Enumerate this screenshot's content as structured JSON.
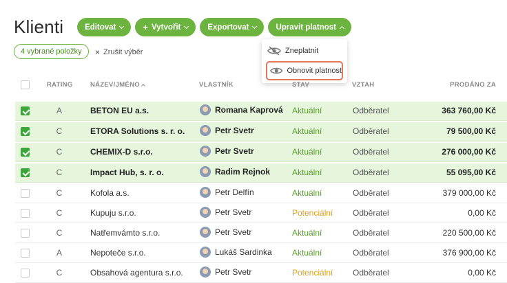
{
  "page": {
    "title": "Klienti"
  },
  "toolbar": {
    "edit_label": "Editovat",
    "create_label": "Vytvořit",
    "export_label": "Exportovat",
    "validity_label": "Upravit platnost"
  },
  "selection": {
    "chip_label": "4 vybrané položky",
    "clear_label": "Zrušit výběr"
  },
  "dropdown": {
    "items": [
      {
        "label": "Zneplatnit",
        "icon": "eye-off-icon"
      },
      {
        "label": "Obnovit platnost",
        "icon": "eye-icon"
      }
    ]
  },
  "table": {
    "headers": {
      "rating": "RATING",
      "name": "NÁZEV/JMÉNO",
      "owner": "VLASTNÍK",
      "state": "STAV",
      "relation": "VZTAH",
      "sold": "PRODÁNO ZA"
    },
    "rows": [
      {
        "selected": true,
        "rating": "A",
        "name": "BETON EU a.s.",
        "owner": "Romana Kaprová",
        "state": "Aktuální",
        "relation": "Odběratel",
        "sold": "363 760,00 Kč"
      },
      {
        "selected": true,
        "rating": "C",
        "name": "ETORA Solutions s. r. o.",
        "owner": "Petr Svetr",
        "state": "Aktuální",
        "relation": "Odběratel",
        "sold": "79 500,00 Kč"
      },
      {
        "selected": true,
        "rating": "C",
        "name": "CHEMIX-D s.r.o.",
        "owner": "Petr Svetr",
        "state": "Aktuální",
        "relation": "Odběratel",
        "sold": "276 000,00 Kč"
      },
      {
        "selected": true,
        "rating": "C",
        "name": "Impact Hub, s. r. o.",
        "owner": "Radim Rejnok",
        "state": "Aktuální",
        "relation": "Odběratel",
        "sold": "55 095,00 Kč"
      },
      {
        "selected": false,
        "rating": "C",
        "name": "Kofola a.s.",
        "owner": "Petr Delfín",
        "state": "Aktuální",
        "relation": "Odběratel",
        "sold": "379 000,00 Kč"
      },
      {
        "selected": false,
        "rating": "C",
        "name": "Kupuju s.r.o.",
        "owner": "Petr Svetr",
        "state": "Potenciální",
        "relation": "Odběratel",
        "sold": "0,00 Kč"
      },
      {
        "selected": false,
        "rating": "C",
        "name": "Natřemvámto s.r.o.",
        "owner": "Petr Svetr",
        "state": "Aktuální",
        "relation": "Odběratel",
        "sold": "220 500,00 Kč"
      },
      {
        "selected": false,
        "rating": "A",
        "name": "Nepoteče s.r.o.",
        "owner": "Lukáš Sardinka",
        "state": "Aktuální",
        "relation": "Odběratel",
        "sold": "376 900,00 Kč"
      },
      {
        "selected": false,
        "rating": "C",
        "name": "Obsahová agentura s.r.o.",
        "owner": "Petr Svetr",
        "state": "Potenciální",
        "relation": "Odběratel",
        "sold": "0,00 Kč"
      }
    ]
  },
  "colors": {
    "accent": "#6cb33f",
    "state_current": "#5aa02c",
    "state_potential": "#e0a21a",
    "highlight_border": "#e2785a",
    "selected_row": "#e6f6dc"
  }
}
